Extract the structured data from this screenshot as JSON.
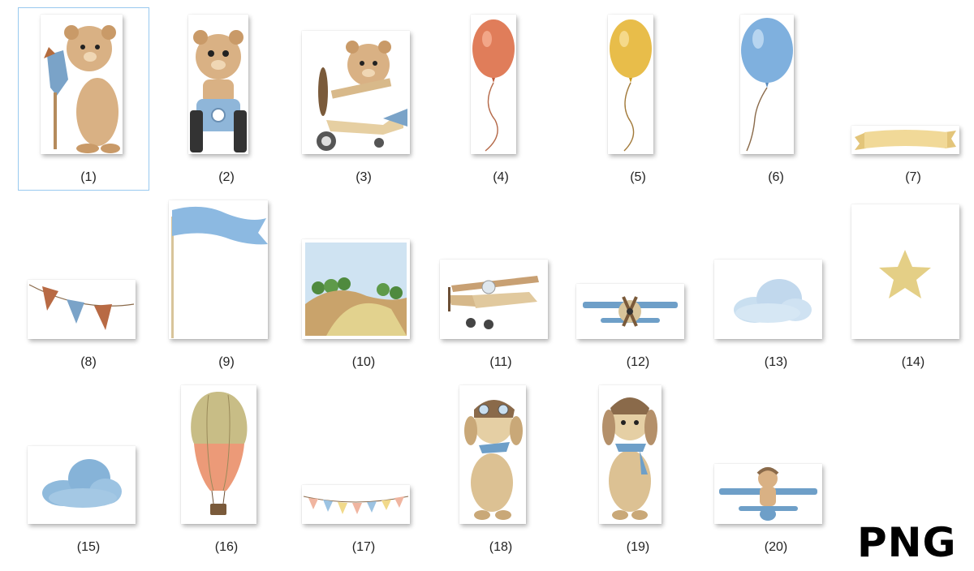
{
  "files": [
    {
      "caption": "(1)",
      "subject": "bear-with-hobby-horse"
    },
    {
      "caption": "(2)",
      "subject": "bear-on-tractor"
    },
    {
      "caption": "(3)",
      "subject": "bear-in-airplane"
    },
    {
      "caption": "(4)",
      "subject": "red-balloon"
    },
    {
      "caption": "(5)",
      "subject": "yellow-balloon"
    },
    {
      "caption": "(6)",
      "subject": "blue-balloon"
    },
    {
      "caption": "(7)",
      "subject": "yellow-ribbon-banner"
    },
    {
      "caption": "(8)",
      "subject": "bunting-flags"
    },
    {
      "caption": "(9)",
      "subject": "blue-flag"
    },
    {
      "caption": "(10)",
      "subject": "hills-landscape"
    },
    {
      "caption": "(11)",
      "subject": "brown-biplane"
    },
    {
      "caption": "(12)",
      "subject": "blue-biplane"
    },
    {
      "caption": "(13)",
      "subject": "light-cloud"
    },
    {
      "caption": "(14)",
      "subject": "yellow-star"
    },
    {
      "caption": "(15)",
      "subject": "blue-cloud"
    },
    {
      "caption": "(16)",
      "subject": "hot-air-balloon"
    },
    {
      "caption": "(17)",
      "subject": "pastel-bunting"
    },
    {
      "caption": "(18)",
      "subject": "puppy-pilot"
    },
    {
      "caption": "(19)",
      "subject": "puppy-pilot-scarf"
    },
    {
      "caption": "(20)",
      "subject": "bear-on-blue-biplane"
    }
  ],
  "badge": "PNG",
  "colors": {
    "selection": "#99c9ef",
    "bear": "#d9b184",
    "sky": "#a9cbe6"
  }
}
